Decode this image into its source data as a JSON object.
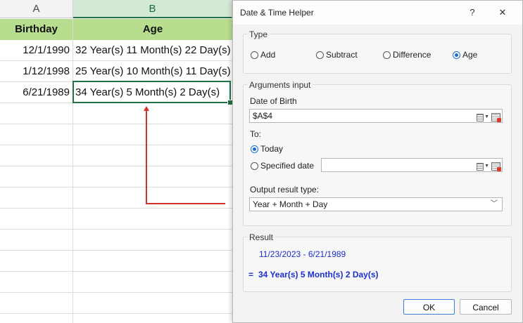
{
  "spreadsheet": {
    "columns": [
      {
        "letter": "A",
        "selected": false
      },
      {
        "letter": "B",
        "selected": true
      }
    ],
    "header_row": {
      "birthday": "Birthday",
      "age": "Age"
    },
    "rows": [
      {
        "birthday": "12/1/1990",
        "age": "32 Year(s) 11 Month(s) 22 Day(s)"
      },
      {
        "birthday": "1/12/1998",
        "age": "25 Year(s) 10 Month(s) 11 Day(s)"
      },
      {
        "birthday": "6/21/1989",
        "age": "34 Year(s) 5 Month(s) 2 Day(s)"
      }
    ],
    "colors": {
      "header_fill": "#b7dd8f",
      "selection": "#217346",
      "arrow": "#d1332e"
    }
  },
  "dialog": {
    "title": "Date & Time Helper",
    "help_label": "?",
    "close_label": "✕",
    "type_group": {
      "title": "Type",
      "options": [
        {
          "label": "Add",
          "checked": false
        },
        {
          "label": "Subtract",
          "checked": false
        },
        {
          "label": "Difference",
          "checked": false
        },
        {
          "label": "Age",
          "checked": true
        }
      ]
    },
    "arguments_group": {
      "title": "Arguments input",
      "dob_label": "Date of Birth",
      "dob_value": "$A$4",
      "to_label": "To:",
      "today_label": "Today",
      "today_checked": true,
      "specified_label": "Specified date",
      "specified_checked": false,
      "specified_value": "",
      "output_label": "Output result type:",
      "output_value": "Year + Month + Day"
    },
    "result_group": {
      "title": "Result",
      "range": "11/23/2023 - 6/21/1989",
      "equals": "=",
      "value": "34 Year(s) 5 Month(s) 2 Day(s)"
    },
    "buttons": {
      "ok": "OK",
      "cancel": "Cancel"
    },
    "colors": {
      "accent": "#1a6fc9",
      "result_text": "#1c2fd0"
    }
  }
}
